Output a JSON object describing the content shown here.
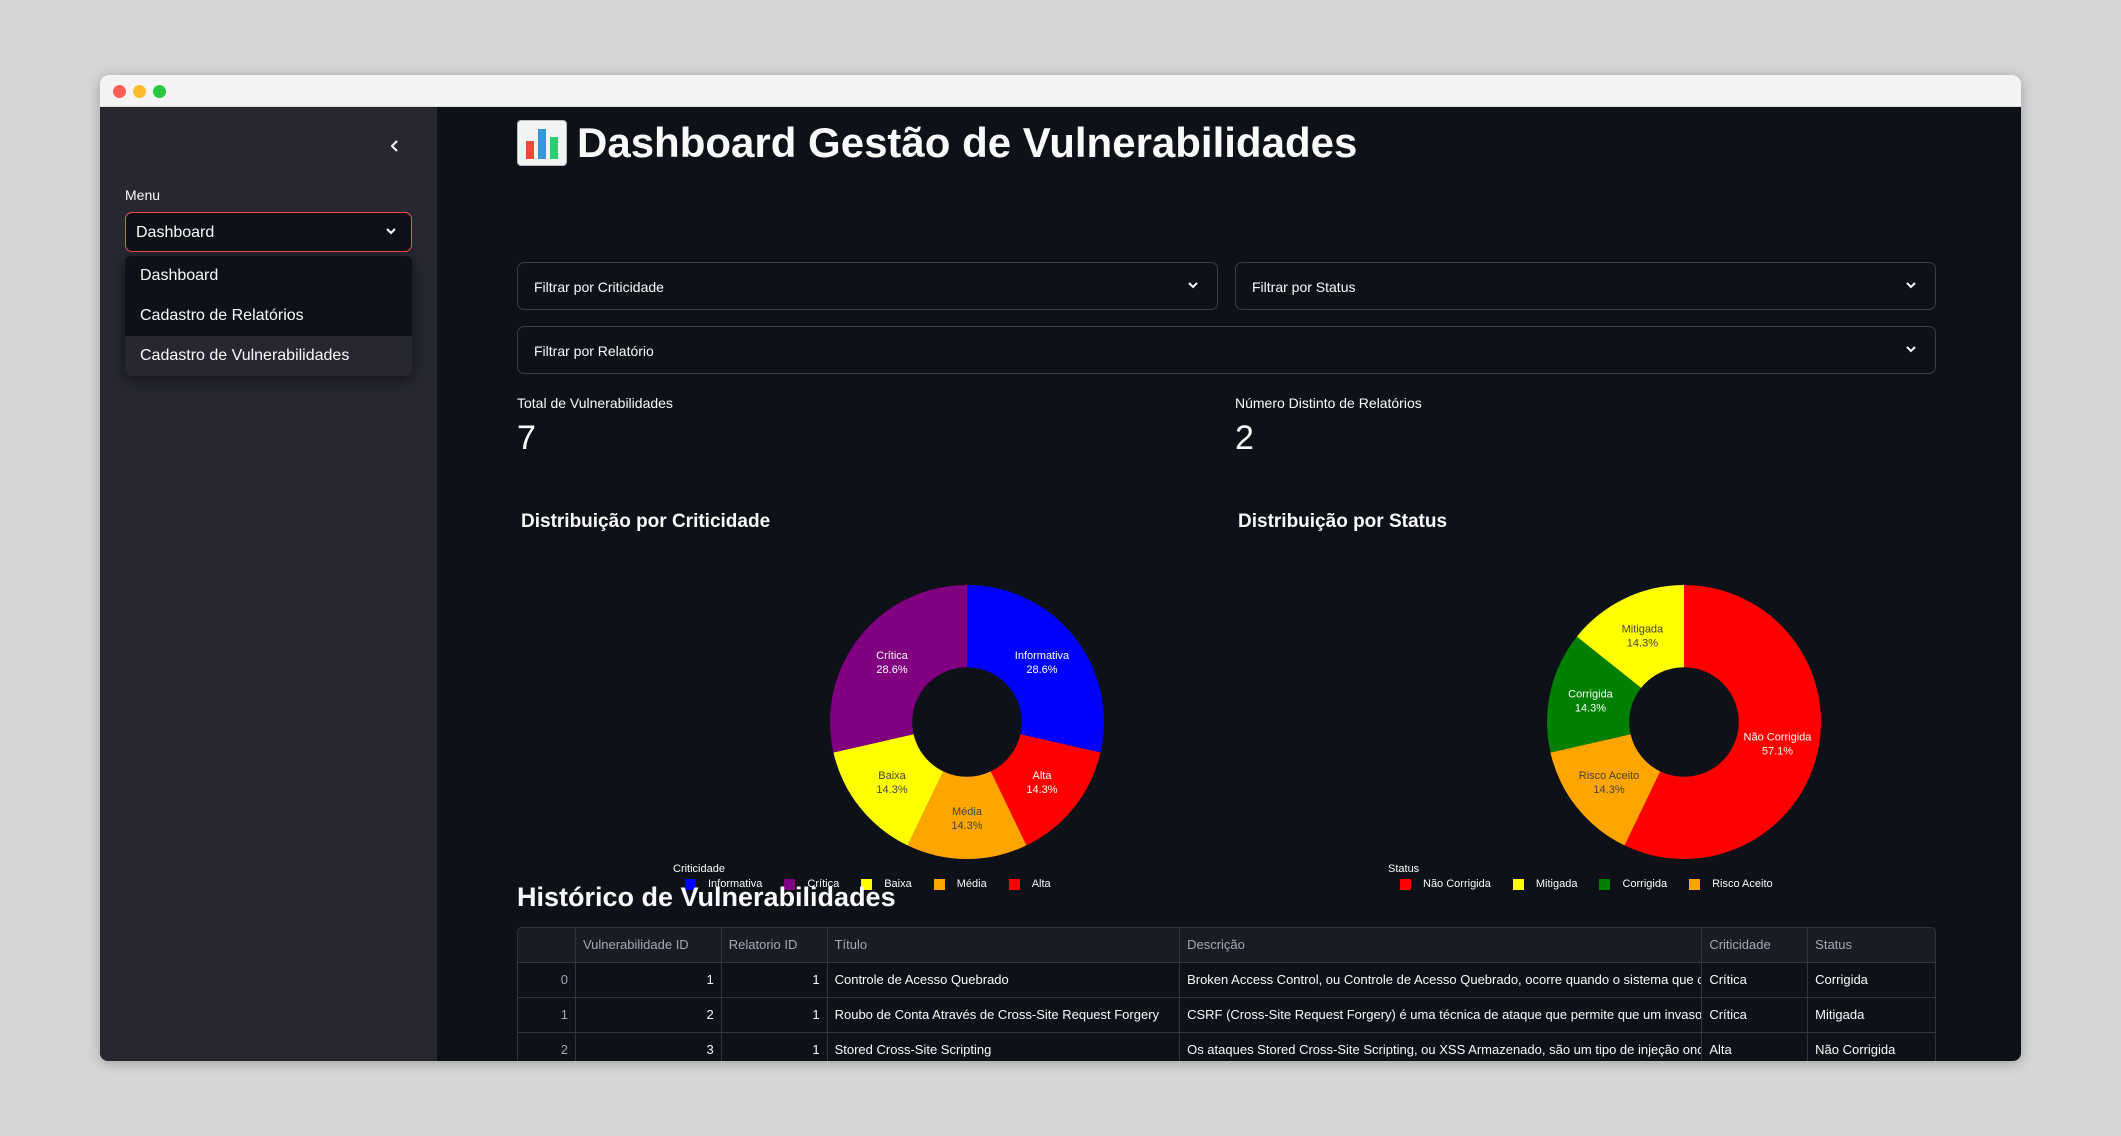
{
  "sidebar": {
    "menu_label": "Menu",
    "selected": "Dashboard",
    "options": [
      "Dashboard",
      "Cadastro de Relatórios",
      "Cadastro de Vulnerabilidades"
    ]
  },
  "header": {
    "title": "Dashboard Gestão de Vulnerabilidades"
  },
  "filters": {
    "criticidade": "Filtrar por Criticidade",
    "status": "Filtrar por Status",
    "relatorio": "Filtrar por Relatório"
  },
  "metrics": {
    "total_label": "Total de Vulnerabilidades",
    "total_value": "7",
    "distinct_label": "Número Distinto de Relatórios",
    "distinct_value": "2"
  },
  "chart_data": [
    {
      "type": "pie",
      "title": "Distribuição por Criticidade",
      "legend_title": "Criticidade",
      "hole": 0.4,
      "labels": [
        "Informativa",
        "Alta",
        "Média",
        "Baixa",
        "Crítica"
      ],
      "values": [
        2,
        1,
        1,
        1,
        2
      ],
      "percents": [
        "28.6%",
        "14.3%",
        "14.3%",
        "14.3%",
        "28.6%"
      ],
      "colors": [
        "#0000ff",
        "#ff0000",
        "#ffa500",
        "#ffff00",
        "#800080"
      ],
      "label_colors": [
        "#ffffff",
        "#ffffff",
        "#444444",
        "#444444",
        "#ffffff"
      ],
      "legend_order": [
        "Informativa",
        "Crítica",
        "Baixa",
        "Média",
        "Alta"
      ],
      "legend_colors": [
        "#0000ff",
        "#800080",
        "#ffff00",
        "#ffa500",
        "#ff0000"
      ]
    },
    {
      "type": "pie",
      "title": "Distribuição por Status",
      "legend_title": "Status",
      "hole": 0.4,
      "labels": [
        "Não Corrigida",
        "Risco Aceito",
        "Corrigida",
        "Mitigada"
      ],
      "values": [
        4,
        1,
        1,
        1
      ],
      "percents": [
        "57.1%",
        "14.3%",
        "14.3%",
        "14.3%"
      ],
      "colors": [
        "#ff0000",
        "#ffa500",
        "#008000",
        "#ffff00"
      ],
      "label_colors": [
        "#ffffff",
        "#444444",
        "#ffffff",
        "#444444"
      ],
      "legend_order": [
        "Não Corrigida",
        "Mitigada",
        "Corrigida",
        "Risco Aceito"
      ],
      "legend_colors": [
        "#ff0000",
        "#ffff00",
        "#008000",
        "#ffa500"
      ]
    }
  ],
  "history": {
    "title": "Histórico de Vulnerabilidades",
    "columns": [
      "",
      "Vulnerabilidade ID",
      "Relatorio ID",
      "Título",
      "Descrição",
      "Criticidade",
      "Status"
    ],
    "rows": [
      [
        "0",
        "1",
        "1",
        "Controle de Acesso Quebrado",
        "Broken Access Control, ou Controle de Acesso Quebrado, ocorre quando o sistema que co",
        "Crítica",
        "Corrigida"
      ],
      [
        "1",
        "2",
        "1",
        "Roubo de Conta Através de Cross-Site Request Forgery",
        "CSRF (Cross-Site Request Forgery) é uma técnica de ataque que permite que um invasor c",
        "Crítica",
        "Mitigada"
      ],
      [
        "2",
        "3",
        "1",
        "Stored Cross-Site Scripting",
        "Os ataques Stored Cross-Site Scripting, ou XSS Armazenado, são um tipo de injeção onde",
        "Alta",
        "Não Corrigida"
      ]
    ]
  }
}
